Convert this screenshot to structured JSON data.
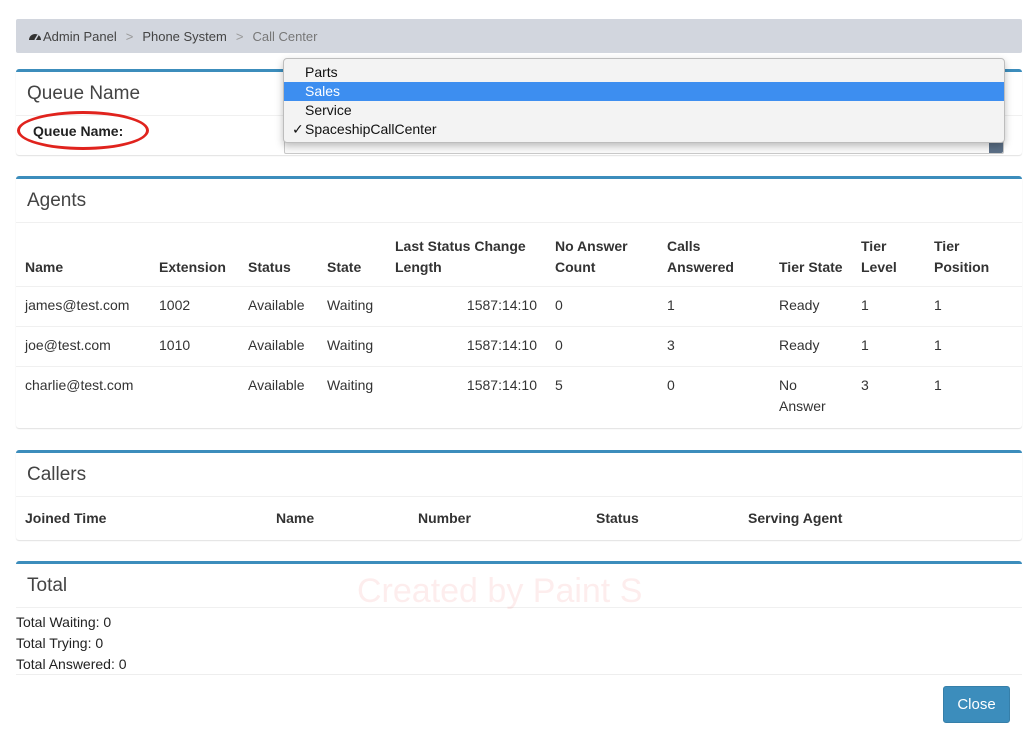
{
  "breadcrumb": {
    "items": [
      "Admin Panel",
      "Phone System",
      "Call Center"
    ]
  },
  "queue_box": {
    "title": "Queue Name",
    "label": "Queue Name:"
  },
  "dropdown": {
    "options": [
      "Parts",
      "Sales",
      "Service",
      "SpaceshipCallCenter"
    ],
    "highlighted": "Sales",
    "selected": "SpaceshipCallCenter",
    "check": "✓"
  },
  "agents": {
    "title": "Agents",
    "headers": [
      "Name",
      "Extension",
      "Status",
      "State",
      "Last Status Change Length",
      "No Answer Count",
      "Calls Answered",
      "Tier State",
      "Tier Level",
      "Tier Position"
    ],
    "rows": [
      [
        "james@test.com",
        "1002",
        "Available",
        "Waiting",
        "1587:14:10",
        "0",
        "1",
        "Ready",
        "1",
        "1"
      ],
      [
        "joe@test.com",
        "1010",
        "Available",
        "Waiting",
        "1587:14:10",
        "0",
        "3",
        "Ready",
        "1",
        "1"
      ],
      [
        "charlie@test.com",
        "",
        "Available",
        "Waiting",
        "1587:14:10",
        "5",
        "0",
        "No Answer",
        "3",
        "1"
      ]
    ]
  },
  "callers": {
    "title": "Callers",
    "headers": [
      "Joined Time",
      "Name",
      "Number",
      "Status",
      "Serving Agent"
    ]
  },
  "total": {
    "title": "Total",
    "lines": [
      "Total Waiting: 0",
      "Total Trying: 0",
      "Total Answered: 0"
    ],
    "close_label": "Close"
  },
  "watermark": "Created by Paint S",
  "colors": {
    "accent": "#3c8dbc",
    "highlight": "#3d8ef0",
    "annotation": "#e0231d"
  }
}
